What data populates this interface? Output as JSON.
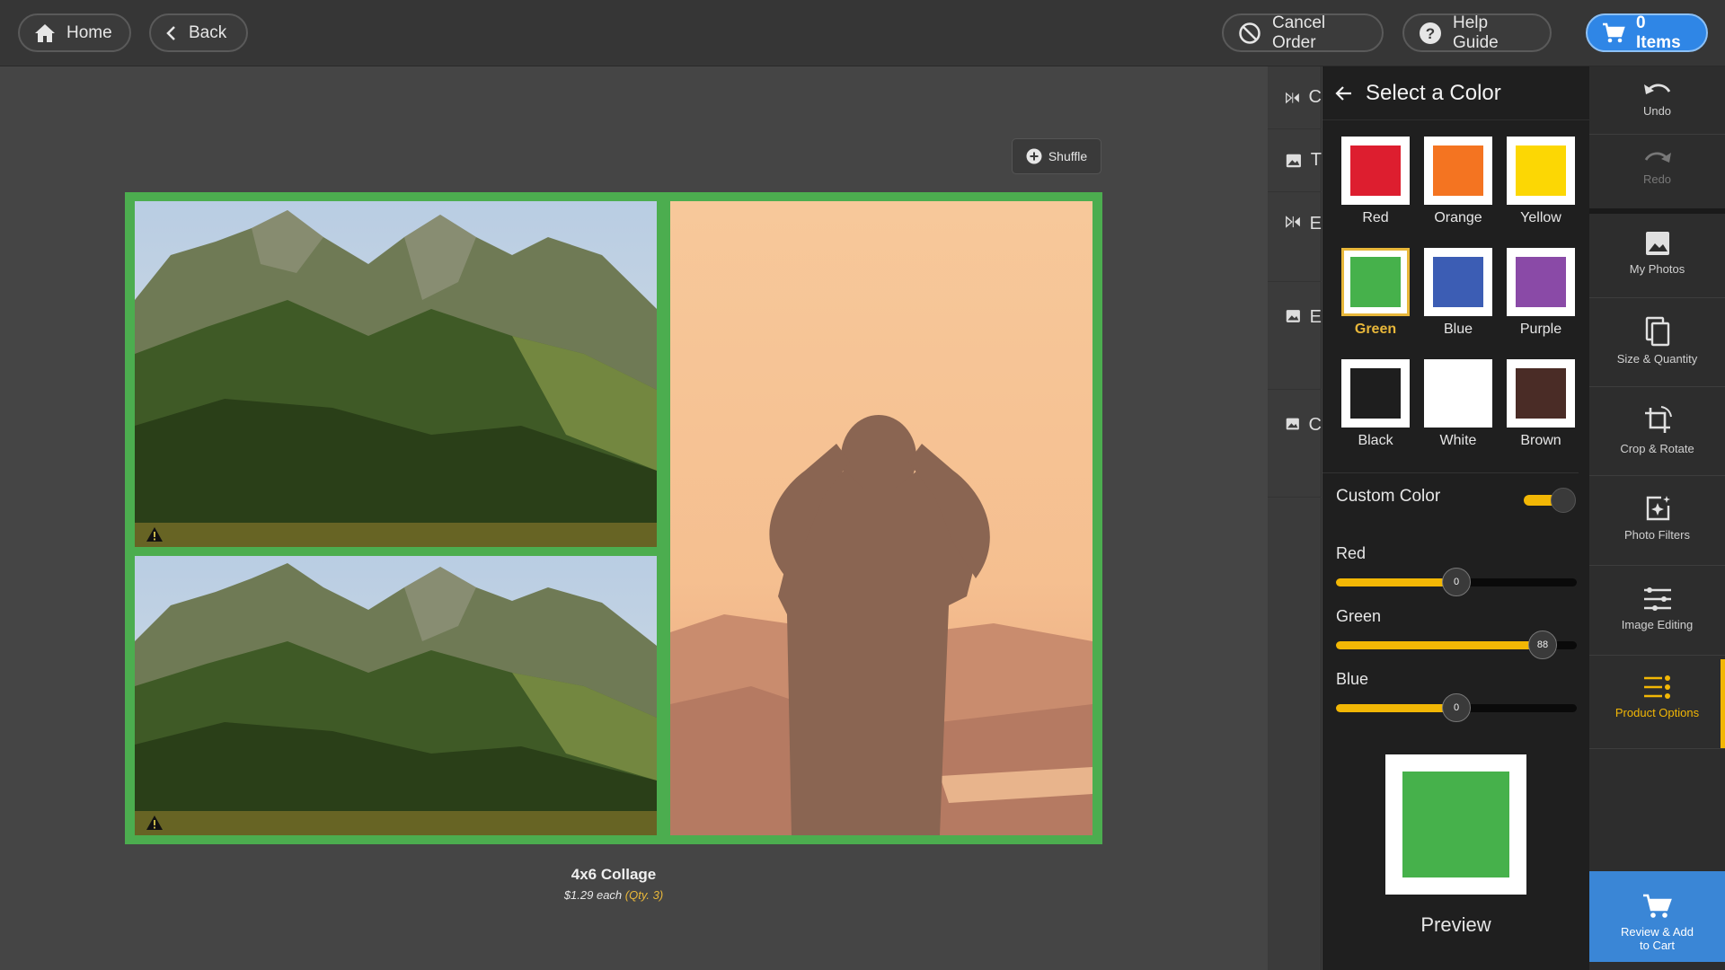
{
  "topbar": {
    "home_label": "Home",
    "back_label": "Back",
    "cancel_label": "Cancel Order",
    "help_label": "Help Guide",
    "cart_label": "0 Items"
  },
  "canvas": {
    "shuffle_label": "Shuffle",
    "collage_title": "4x6 Collage",
    "price_text": "$1.29 each",
    "qty_text": "(Qty. 3)",
    "border_color": "#4cad4f"
  },
  "options_column": {
    "rows": [
      "C",
      "T",
      "E",
      "E",
      "C"
    ]
  },
  "color_panel": {
    "title": "Select a Color",
    "swatches": [
      {
        "label": "Red",
        "color": "#dd1e2f"
      },
      {
        "label": "Orange",
        "color": "#f47421"
      },
      {
        "label": "Yellow",
        "color": "#fcd704"
      },
      {
        "label": "Green",
        "color": "#46b14b"
      },
      {
        "label": "Blue",
        "color": "#3c5db4"
      },
      {
        "label": "Purple",
        "color": "#8a4aa7"
      },
      {
        "label": "Black",
        "color": "#1e1e1e"
      },
      {
        "label": "White",
        "color": "#ffffff"
      },
      {
        "label": "Brown",
        "color": "#4a2c26"
      }
    ],
    "selected_swatch": "Green",
    "custom_color_label": "Custom Color",
    "custom_color_enabled": true,
    "sliders": [
      {
        "label": "Red",
        "value": "0",
        "fill": 0.5
      },
      {
        "label": "Green",
        "value": "88",
        "fill": 0.86
      },
      {
        "label": "Blue",
        "value": "0",
        "fill": 0.5
      }
    ],
    "preview_color": "#46b14b",
    "preview_label": "Preview"
  },
  "sidebar": {
    "undo": "Undo",
    "redo": "Redo",
    "my_photos": "My Photos",
    "size_quantity": "Size & Quantity",
    "crop_rotate": "Crop & Rotate",
    "photo_filters": "Photo Filters",
    "image_editing": "Image Editing",
    "product_options": "Product Options",
    "review_line1": "Review & Add",
    "review_line2": "to Cart"
  }
}
